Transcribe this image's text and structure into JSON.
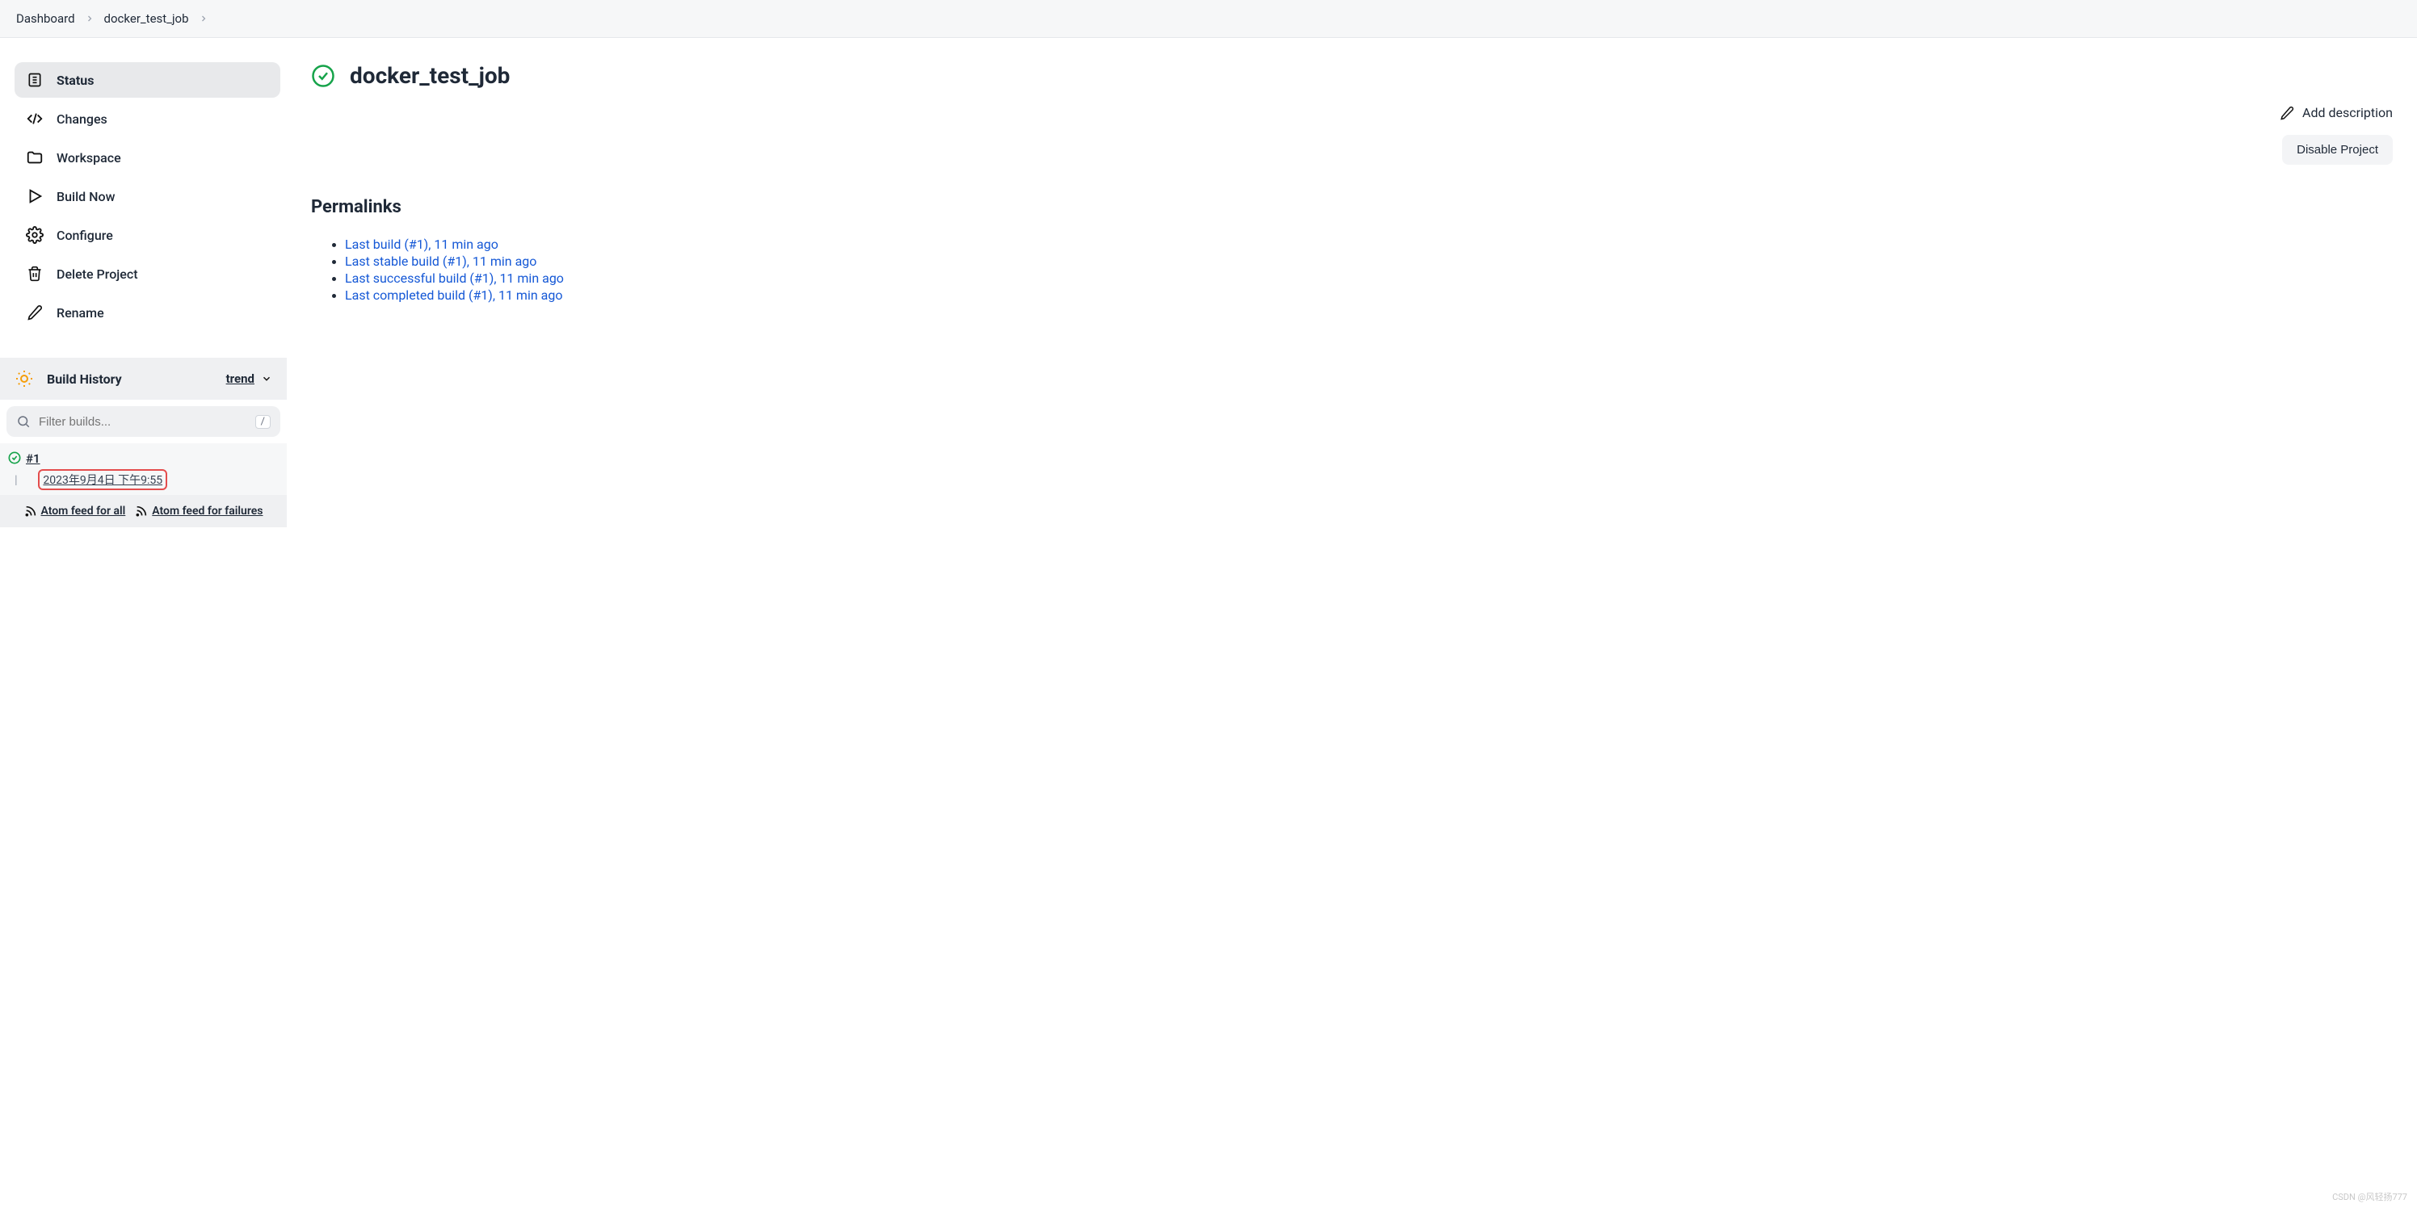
{
  "breadcrumb": {
    "items": [
      "Dashboard",
      "docker_test_job"
    ]
  },
  "sidebar": {
    "nav": {
      "status": "Status",
      "changes": "Changes",
      "workspace": "Workspace",
      "build_now": "Build Now",
      "configure": "Configure",
      "delete_project": "Delete Project",
      "rename": "Rename"
    },
    "build_history": {
      "title": "Build History",
      "trend_label": "trend",
      "filter_placeholder": "Filter builds...",
      "filter_key": "/",
      "builds": [
        {
          "number": "#1",
          "time": "2023年9月4日 下午9:55"
        }
      ],
      "atom_all": "Atom feed for all",
      "atom_failures": "Atom feed for failures"
    }
  },
  "main": {
    "title": "docker_test_job",
    "add_description": "Add description",
    "disable_project": "Disable Project",
    "permalinks_title": "Permalinks",
    "permalinks": [
      "Last build (#1), 11 min ago",
      "Last stable build (#1), 11 min ago",
      "Last successful build (#1), 11 min ago",
      "Last completed build (#1), 11 min ago"
    ]
  },
  "watermark": "CSDN @风轻扬777"
}
